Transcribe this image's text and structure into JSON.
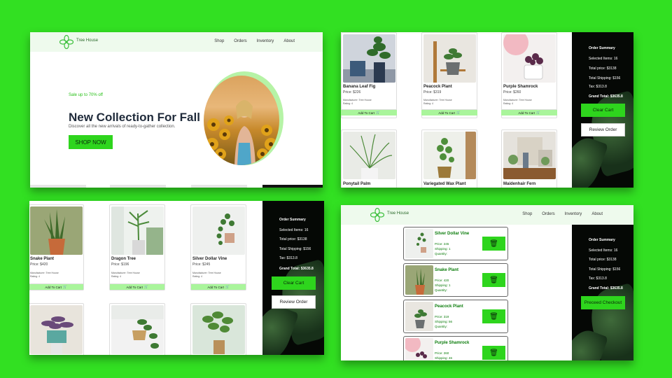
{
  "brand": {
    "name": "Tree House"
  },
  "nav": {
    "items": [
      "Shop",
      "Orders",
      "Inventory",
      "About"
    ]
  },
  "hero": {
    "sale": "Sale up to 70% off",
    "title": "New Collection For Fall",
    "subtitle": "Discover all the new arrivals of ready-to-gather collection.",
    "cta": "SHOP NOW"
  },
  "products": [
    {
      "name": "Banana Leaf Fig",
      "price": "Price: $226",
      "manufacturer": "Manufacturer: Tree House",
      "rating": "Rating: 4",
      "add": "Add To Cart"
    },
    {
      "name": "Peacock Plant",
      "price": "Price: $319",
      "manufacturer": "Manufacturer: Tree House",
      "rating": "Rating: 4",
      "add": "Add To Cart"
    },
    {
      "name": "Purple Shamrock",
      "price": "Price: $260",
      "manufacturer": "Manufacturer: Tree House",
      "rating": "Rating: 4",
      "add": "Add To Cart"
    },
    {
      "name": "Ponytail Palm"
    },
    {
      "name": "Variegated Wax Plant"
    },
    {
      "name": "Maidenhair Fern"
    },
    {
      "name": "Snake Plant",
      "price": "Price: $420",
      "manufacturer": "Manufacturer: Tree House",
      "rating": "Rating: 4",
      "add": "Add To Cart"
    },
    {
      "name": "Dragon Tree",
      "price": "Price: $196",
      "manufacturer": "Manufacturer: Tree House",
      "rating": "Rating: 4",
      "add": "Add To Cart"
    },
    {
      "name": "Silver Dollar Vine",
      "price": "Price: $245",
      "manufacturer": "Manufacturer: Tree House",
      "rating": "Rating: 4",
      "add": "Add To Cart"
    }
  ],
  "summary": {
    "title": "Order Summary",
    "items": "Selected Items: 16",
    "price": "Total price: $3138",
    "shipping": "Total Shipping: $156",
    "tax": "Tax: $313.8",
    "grand": "Grand Total: $3635.8",
    "clear": "Clear Cart",
    "review": "Review Order",
    "checkout": "Preceed Checkout"
  },
  "cart": [
    {
      "name": "Silver Dollar Vine",
      "price": "Price: 245",
      "shipping": "Shipping: 1",
      "quantity": "Quantity:"
    },
    {
      "name": "Snake Plant",
      "price": "Price: 420",
      "shipping": "Shipping: 1",
      "quantity": "Quantity:"
    },
    {
      "name": "Peacock Plant",
      "price": "Price: 319",
      "shipping": "Shipping: 56",
      "quantity": "Quantity:"
    },
    {
      "name": "Purple Shamrock",
      "price": "Price: 260",
      "shipping": "Shipping: 46",
      "quantity": ""
    }
  ],
  "colors": {
    "background": "#32e022",
    "accent": "#2ed51d",
    "addCart": "#a9f59b",
    "cartText": "#0b7c0b"
  },
  "icons": [
    "logo-icon",
    "cart-icon",
    "trash-icon"
  ]
}
